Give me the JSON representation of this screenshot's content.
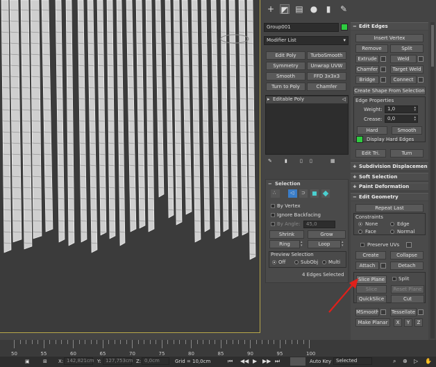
{
  "object_name": "Group001",
  "object_color": "#2ecc40",
  "modifier_list": "Modifier List",
  "modifier_buttons": [
    "Edit Poly",
    "TurboSmooth",
    "Symmetry",
    "Unwrap UVW",
    "Smooth",
    "FFD 3x3x3",
    "Turn to Poly",
    "Chamfer"
  ],
  "stack_item": "Editable Poly",
  "selection": {
    "title": "Selection",
    "by_vertex": "By Vertex",
    "ignore_backfacing": "Ignore Backfacing",
    "by_angle": "By Angle:",
    "by_angle_value": "45,0",
    "shrink": "Shrink",
    "grow": "Grow",
    "ring": "Ring",
    "loop": "Loop",
    "preview_title": "Preview Selection",
    "off": "Off",
    "subobj": "SubObj",
    "multi": "Multi",
    "status": "4 Edges Selected"
  },
  "edit_edges": {
    "title": "Edit Edges",
    "insert_vertex": "Insert Vertex",
    "remove": "Remove",
    "split": "Split",
    "extrude": "Extrude",
    "weld": "Weld",
    "chamfer": "Chamfer",
    "target_weld": "Target Weld",
    "bridge": "Bridge",
    "connect": "Connect",
    "create_shape": "Create Shape From Selection",
    "edge_props": "Edge Properties",
    "weight_label": "Weight:",
    "weight_value": "1,0",
    "crease_label": "Crease:",
    "crease_value": "0,0",
    "hard": "Hard",
    "smooth": "Smooth",
    "display_hard": "Display Hard Edges",
    "edit_tri": "Edit Tri.",
    "turn": "Turn"
  },
  "rollouts": [
    "Subdivision Displacemen",
    "Soft Selection",
    "Paint Deformation"
  ],
  "edit_geometry": {
    "title": "Edit Geometry",
    "repeat_last": "Repeat Last",
    "constraints": "Constraints",
    "none": "None",
    "edge": "Edge",
    "face": "Face",
    "normal": "Normal",
    "preserve_uvs": "Preserve UVs",
    "create": "Create",
    "collapse": "Collapse",
    "attach": "Attach",
    "detach": "Detach",
    "slice_plane": "Slice Plane",
    "split": "Split",
    "slice": "Slice",
    "reset_plane": "Reset Plane",
    "quickslice": "QuickSlice",
    "cut": "Cut",
    "msmooth": "MSmooth",
    "tessellate": "Tessellate",
    "make_planar": "Make Planar",
    "x": "X",
    "y": "Y",
    "z": "Z"
  },
  "timeline_ticks": [
    "50",
    "55",
    "60",
    "65",
    "70",
    "75",
    "80",
    "85",
    "90",
    "95",
    "100"
  ],
  "status_bar": {
    "x_label": "X:",
    "x_value": "142,821cm",
    "y_label": "Y:",
    "y_value": "127,753cm",
    "z_label": "Z:",
    "z_value": "0,0cm",
    "grid": "Grid = 10,0cm",
    "auto_key": "Auto Key",
    "selected": "Selected"
  },
  "colors": {
    "accent_arrow": "#e0201a",
    "viewport_border": "#b9a84a"
  }
}
